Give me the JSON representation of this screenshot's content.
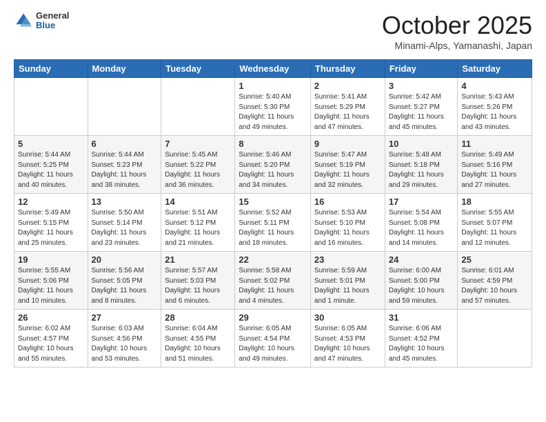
{
  "header": {
    "logo_general": "General",
    "logo_blue": "Blue",
    "month": "October 2025",
    "subtitle": "Minami-Alps, Yamanashi, Japan"
  },
  "weekdays": [
    "Sunday",
    "Monday",
    "Tuesday",
    "Wednesday",
    "Thursday",
    "Friday",
    "Saturday"
  ],
  "weeks": [
    [
      {
        "day": "",
        "info": ""
      },
      {
        "day": "",
        "info": ""
      },
      {
        "day": "",
        "info": ""
      },
      {
        "day": "1",
        "info": "Sunrise: 5:40 AM\nSunset: 5:30 PM\nDaylight: 11 hours\nand 49 minutes."
      },
      {
        "day": "2",
        "info": "Sunrise: 5:41 AM\nSunset: 5:29 PM\nDaylight: 11 hours\nand 47 minutes."
      },
      {
        "day": "3",
        "info": "Sunrise: 5:42 AM\nSunset: 5:27 PM\nDaylight: 11 hours\nand 45 minutes."
      },
      {
        "day": "4",
        "info": "Sunrise: 5:43 AM\nSunset: 5:26 PM\nDaylight: 11 hours\nand 43 minutes."
      }
    ],
    [
      {
        "day": "5",
        "info": "Sunrise: 5:44 AM\nSunset: 5:25 PM\nDaylight: 11 hours\nand 40 minutes."
      },
      {
        "day": "6",
        "info": "Sunrise: 5:44 AM\nSunset: 5:23 PM\nDaylight: 11 hours\nand 38 minutes."
      },
      {
        "day": "7",
        "info": "Sunrise: 5:45 AM\nSunset: 5:22 PM\nDaylight: 11 hours\nand 36 minutes."
      },
      {
        "day": "8",
        "info": "Sunrise: 5:46 AM\nSunset: 5:20 PM\nDaylight: 11 hours\nand 34 minutes."
      },
      {
        "day": "9",
        "info": "Sunrise: 5:47 AM\nSunset: 5:19 PM\nDaylight: 11 hours\nand 32 minutes."
      },
      {
        "day": "10",
        "info": "Sunrise: 5:48 AM\nSunset: 5:18 PM\nDaylight: 11 hours\nand 29 minutes."
      },
      {
        "day": "11",
        "info": "Sunrise: 5:49 AM\nSunset: 5:16 PM\nDaylight: 11 hours\nand 27 minutes."
      }
    ],
    [
      {
        "day": "12",
        "info": "Sunrise: 5:49 AM\nSunset: 5:15 PM\nDaylight: 11 hours\nand 25 minutes."
      },
      {
        "day": "13",
        "info": "Sunrise: 5:50 AM\nSunset: 5:14 PM\nDaylight: 11 hours\nand 23 minutes."
      },
      {
        "day": "14",
        "info": "Sunrise: 5:51 AM\nSunset: 5:12 PM\nDaylight: 11 hours\nand 21 minutes."
      },
      {
        "day": "15",
        "info": "Sunrise: 5:52 AM\nSunset: 5:11 PM\nDaylight: 11 hours\nand 18 minutes."
      },
      {
        "day": "16",
        "info": "Sunrise: 5:53 AM\nSunset: 5:10 PM\nDaylight: 11 hours\nand 16 minutes."
      },
      {
        "day": "17",
        "info": "Sunrise: 5:54 AM\nSunset: 5:08 PM\nDaylight: 11 hours\nand 14 minutes."
      },
      {
        "day": "18",
        "info": "Sunrise: 5:55 AM\nSunset: 5:07 PM\nDaylight: 11 hours\nand 12 minutes."
      }
    ],
    [
      {
        "day": "19",
        "info": "Sunrise: 5:55 AM\nSunset: 5:06 PM\nDaylight: 11 hours\nand 10 minutes."
      },
      {
        "day": "20",
        "info": "Sunrise: 5:56 AM\nSunset: 5:05 PM\nDaylight: 11 hours\nand 8 minutes."
      },
      {
        "day": "21",
        "info": "Sunrise: 5:57 AM\nSunset: 5:03 PM\nDaylight: 11 hours\nand 6 minutes."
      },
      {
        "day": "22",
        "info": "Sunrise: 5:58 AM\nSunset: 5:02 PM\nDaylight: 11 hours\nand 4 minutes."
      },
      {
        "day": "23",
        "info": "Sunrise: 5:59 AM\nSunset: 5:01 PM\nDaylight: 11 hours\nand 1 minute."
      },
      {
        "day": "24",
        "info": "Sunrise: 6:00 AM\nSunset: 5:00 PM\nDaylight: 10 hours\nand 59 minutes."
      },
      {
        "day": "25",
        "info": "Sunrise: 6:01 AM\nSunset: 4:59 PM\nDaylight: 10 hours\nand 57 minutes."
      }
    ],
    [
      {
        "day": "26",
        "info": "Sunrise: 6:02 AM\nSunset: 4:57 PM\nDaylight: 10 hours\nand 55 minutes."
      },
      {
        "day": "27",
        "info": "Sunrise: 6:03 AM\nSunset: 4:56 PM\nDaylight: 10 hours\nand 53 minutes."
      },
      {
        "day": "28",
        "info": "Sunrise: 6:04 AM\nSunset: 4:55 PM\nDaylight: 10 hours\nand 51 minutes."
      },
      {
        "day": "29",
        "info": "Sunrise: 6:05 AM\nSunset: 4:54 PM\nDaylight: 10 hours\nand 49 minutes."
      },
      {
        "day": "30",
        "info": "Sunrise: 6:05 AM\nSunset: 4:53 PM\nDaylight: 10 hours\nand 47 minutes."
      },
      {
        "day": "31",
        "info": "Sunrise: 6:06 AM\nSunset: 4:52 PM\nDaylight: 10 hours\nand 45 minutes."
      },
      {
        "day": "",
        "info": ""
      }
    ]
  ]
}
